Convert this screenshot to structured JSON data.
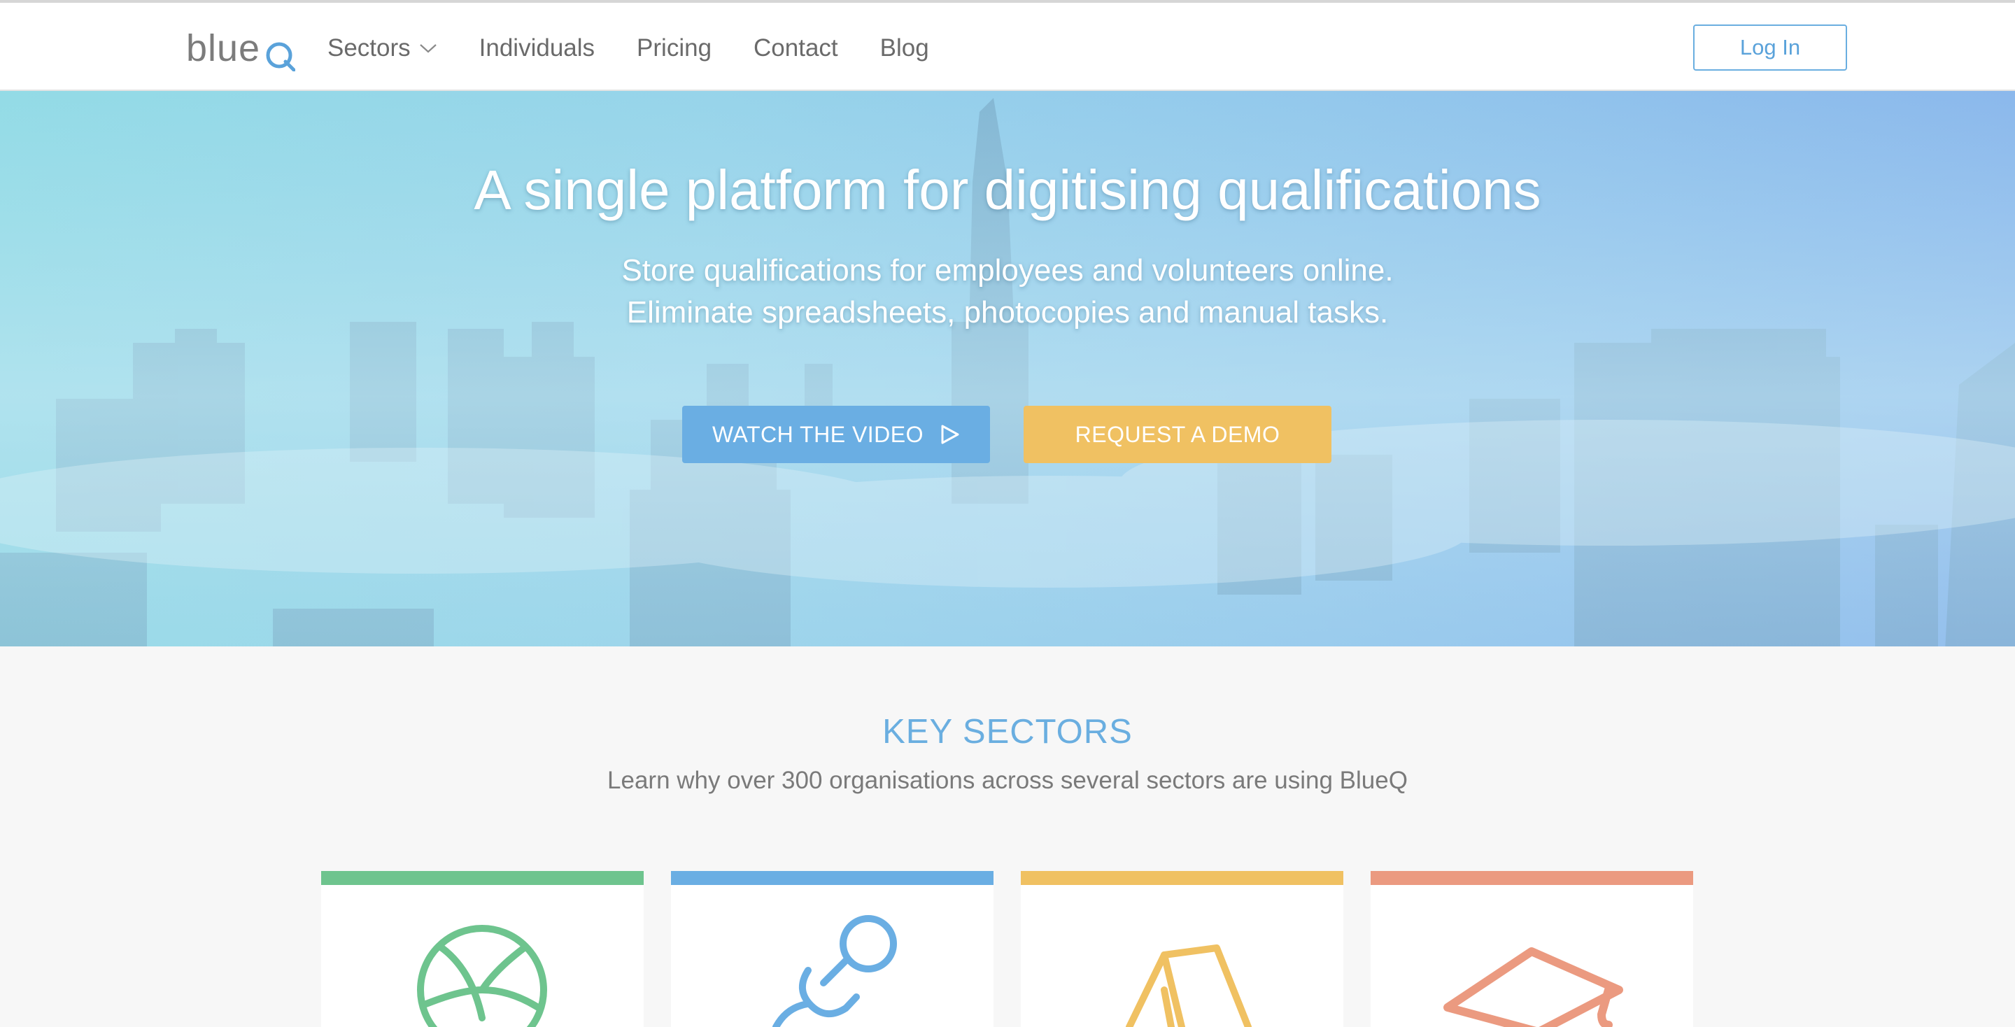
{
  "nav": {
    "logo_text": "blue",
    "links": [
      {
        "label": "Sectors",
        "has_dropdown": true
      },
      {
        "label": "Individuals"
      },
      {
        "label": "Pricing"
      },
      {
        "label": "Contact"
      },
      {
        "label": "Blog"
      }
    ],
    "login_label": "Log In"
  },
  "hero": {
    "title": "A single platform for digitising qualifications",
    "subtitle_line1": "Store qualifications for employees and volunteers online.",
    "subtitle_line2": "Eliminate spreadsheets, photocopies and manual tasks.",
    "video_button": "WATCH THE VIDEO",
    "demo_button": "REQUEST A DEMO"
  },
  "sectors": {
    "title": "KEY SECTORS",
    "subtitle": "Learn why over 300 organisations across several sectors are using BlueQ",
    "cards": [
      {
        "icon": "sports-ball-icon",
        "color": "#6ec48e"
      },
      {
        "icon": "pacifier-icon",
        "color": "#6aaee3"
      },
      {
        "icon": "tent-icon",
        "color": "#f0c162"
      },
      {
        "icon": "graduation-cap-icon",
        "color": "#eb9a80"
      }
    ]
  },
  "colors": {
    "brand_blue": "#6aaee0",
    "demo_yellow": "#f0c162",
    "sport_green": "#6ec48e",
    "edu_salmon": "#eb9a80"
  }
}
